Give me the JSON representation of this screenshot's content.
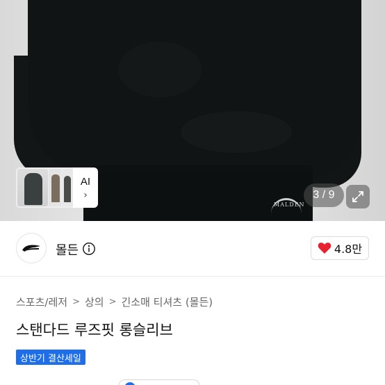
{
  "gallery": {
    "thumbnail_label": "AI",
    "page_indicator": "3 / 9",
    "current_image": 3,
    "total_images": 9
  },
  "store": {
    "name": "몰든",
    "rating": "4.8만"
  },
  "breadcrumb": {
    "items": [
      "스포츠/레저",
      "상의",
      "긴소매 티셔츠 (몰든)"
    ]
  },
  "product": {
    "title": "스탠다드 루즈핏 롱슬리브",
    "badge": "상반기 결산세일"
  },
  "colors": {
    "badge_bg": "#1e6ee9",
    "heart": "#e8202f"
  }
}
